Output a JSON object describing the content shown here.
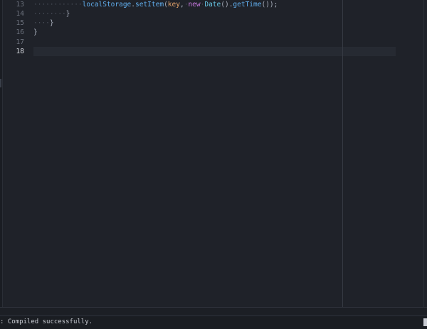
{
  "editor": {
    "line_numbers": [
      "13",
      "14",
      "15",
      "16",
      "17",
      "18"
    ],
    "active_line": "18",
    "lines": [
      {
        "indent": "············",
        "tokens": {
          "obj": "localStorage",
          "dot1": ".",
          "method": "setItem",
          "open": "(",
          "arg1": "key",
          "comma": ",",
          "sp": "·",
          "new": "new",
          "sp2": "·",
          "cls": "Date",
          "call": "()",
          "dot2": ".",
          "method2": "getTime",
          "close": "());"
        }
      },
      {
        "indent": "········",
        "text": "}"
      },
      {
        "indent": "····",
        "text": "}"
      },
      {
        "indent": "",
        "text": "}"
      },
      {
        "indent": "",
        "text": ""
      },
      {
        "indent": "",
        "text": ""
      }
    ]
  },
  "statusbar": {
    "message": ": Compiled successfully."
  },
  "colors": {
    "background": "#1f2229",
    "function": "#61afef",
    "parameter": "#e5a46b",
    "keyword": "#c678dd",
    "class": "#66c7e6",
    "whitespace_marker": "#4d535e"
  }
}
